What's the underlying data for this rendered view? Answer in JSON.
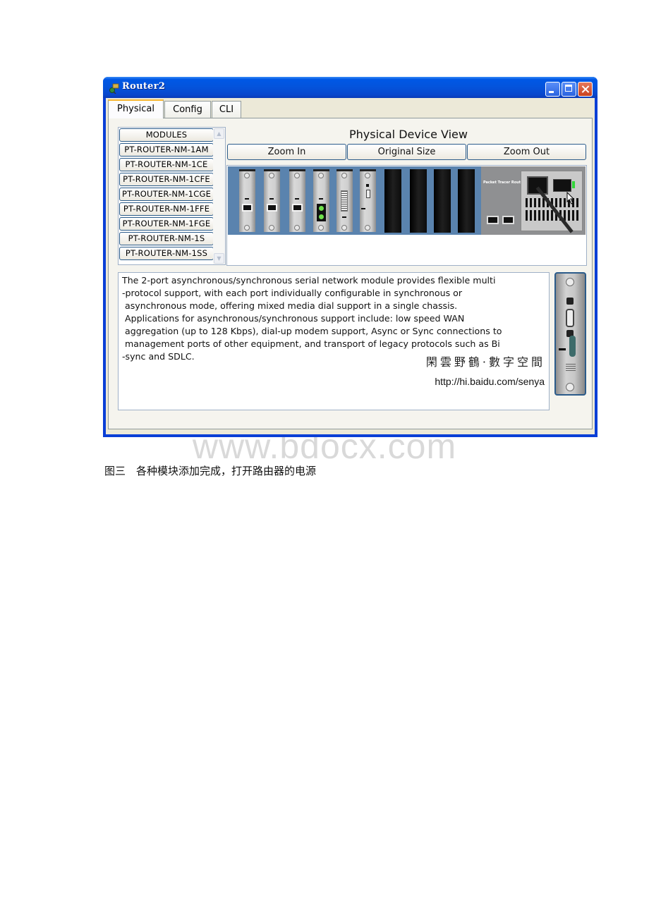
{
  "window": {
    "title": "Router2",
    "controls": [
      "minimize",
      "maximize",
      "close"
    ]
  },
  "tabs": [
    {
      "label": "Physical",
      "active": true
    },
    {
      "label": "Config",
      "active": false
    },
    {
      "label": "CLI",
      "active": false
    }
  ],
  "modules": {
    "header": "MODULES",
    "items": [
      "PT-ROUTER-NM-1AM",
      "PT-ROUTER-NM-1CE",
      "PT-ROUTER-NM-1CFE",
      "PT-ROUTER-NM-1CGE",
      "PT-ROUTER-NM-1FFE",
      "PT-ROUTER-NM-1FGE",
      "PT-ROUTER-NM-1S",
      "PT-ROUTER-NM-1SS"
    ]
  },
  "device_view": {
    "title": "Physical Device View",
    "buttons": {
      "zoom_in": "Zoom In",
      "original_size": "Original Size",
      "zoom_out": "Zoom Out"
    },
    "router_label": "Packet Tracer Router",
    "installed_modules": [
      "ethernet",
      "ethernet",
      "ethernet",
      "fiber",
      "serial",
      "serial"
    ],
    "empty_slots": 4,
    "power": "on",
    "ports": [
      "CONSOLE",
      "AUX"
    ]
  },
  "description": {
    "lines": [
      "The 2-port asynchronous/synchronous serial network module provides flexible multi",
      "-protocol support, with each port individually configurable in synchronous or",
      " asynchronous mode, offering mixed media dial support in a single chassis.",
      " Applications for asynchronous/synchronous support include: low speed WAN",
      " aggregation (up to 128 Kbps), dial-up modem support, Async or Sync connections to",
      " management ports of other equipment, and transport of legacy protocols such as Bi",
      "-sync and SDLC."
    ],
    "watermark_cn": "閑雲野鶴·數字空間",
    "watermark_url": "http://hi.baidu.com/senya"
  },
  "page": {
    "watermark": "www.bdocx.com",
    "caption": "图三　各种模块添加完成，打开路由器的电源"
  }
}
